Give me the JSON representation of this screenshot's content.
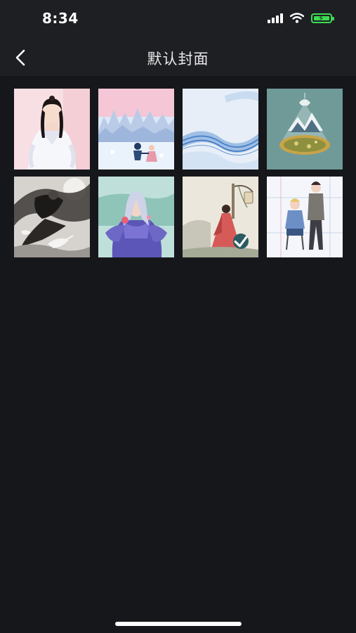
{
  "status_bar": {
    "time": "8:34"
  },
  "nav": {
    "title": "默认封面",
    "back_icon": "chevron-left-icon"
  },
  "covers": [
    {
      "id": 1,
      "subject": "girl-in-white",
      "selected": false
    },
    {
      "id": 2,
      "subject": "winter-town-skating",
      "selected": false
    },
    {
      "id": 3,
      "subject": "blue-wave",
      "selected": false
    },
    {
      "id": 4,
      "subject": "terrarium-landscape",
      "selected": false
    },
    {
      "id": 5,
      "subject": "ink-swordsman-cranes",
      "selected": false
    },
    {
      "id": 6,
      "subject": "purple-robed-immortal",
      "selected": false
    },
    {
      "id": 7,
      "subject": "red-robed-lady-lantern",
      "selected": true
    },
    {
      "id": 8,
      "subject": "two-boys-classroom",
      "selected": false
    }
  ],
  "colors": {
    "background": "#16171b",
    "nav_background": "#1e1f23",
    "battery": "#3ddc53",
    "check_badge": "#2a5b63"
  }
}
